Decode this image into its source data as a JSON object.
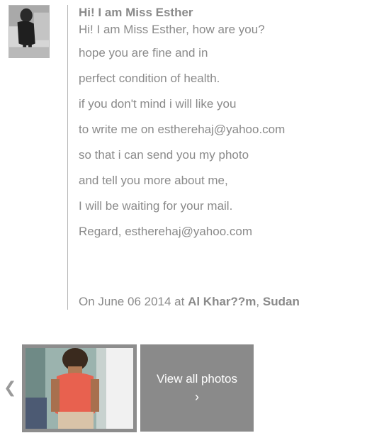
{
  "message": {
    "title": "Hi! I am Miss Esther",
    "lines": [
      "Hi! I am Miss Esther, how are you?",
      "hope you are fine and in",
      "perfect condition of health.",
      "if you don't mind i will like you",
      "to write me on estherehaj@yahoo.com",
      "so that i can send you my photo",
      "and tell you more about me,",
      "I will be waiting for your mail.",
      "Regard, estherehaj@yahoo.com"
    ]
  },
  "meta": {
    "date_prefix": "On June 06 2014 at",
    "city": "Al Khar??m",
    "separator": ",",
    "country": "Sudan"
  },
  "gallery": {
    "prev_arrow": "❮",
    "view_all_label": "View all photos",
    "view_all_arrow": "›"
  },
  "icons": {
    "prev": "chevron-left-icon",
    "next": "chevron-right-icon"
  }
}
